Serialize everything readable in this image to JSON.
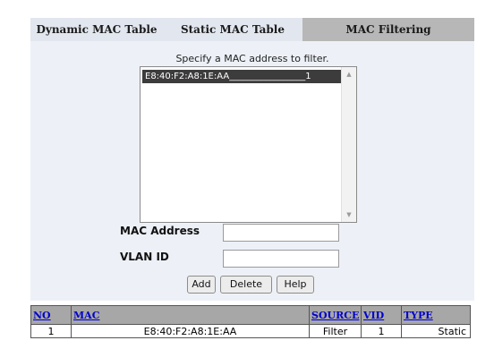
{
  "tabs": [
    {
      "label": "Dynamic MAC Table",
      "active": false
    },
    {
      "label": "Static MAC Table",
      "active": false
    },
    {
      "label": "MAC Filtering",
      "active": true
    }
  ],
  "filter": {
    "prompt": "Specify a MAC address to filter.",
    "list_items": [
      "E8:40:F2:A8:1E:AA_________________1"
    ],
    "selected_index": 0
  },
  "form": {
    "mac_label": "MAC Address",
    "mac_value": "",
    "vlan_label": "VLAN ID",
    "vlan_value": ""
  },
  "buttons": {
    "add": "Add",
    "delete": "Delete",
    "help": "Help"
  },
  "table": {
    "headers": {
      "no": "NO",
      "mac": "MAC",
      "source": "SOURCE",
      "vid": "VID",
      "type": "TYPE"
    },
    "rows": [
      {
        "no": "1",
        "mac": "E8:40:F2:A8:1E:AA",
        "source": "Filter",
        "vid": "1",
        "type": "Static"
      }
    ]
  }
}
